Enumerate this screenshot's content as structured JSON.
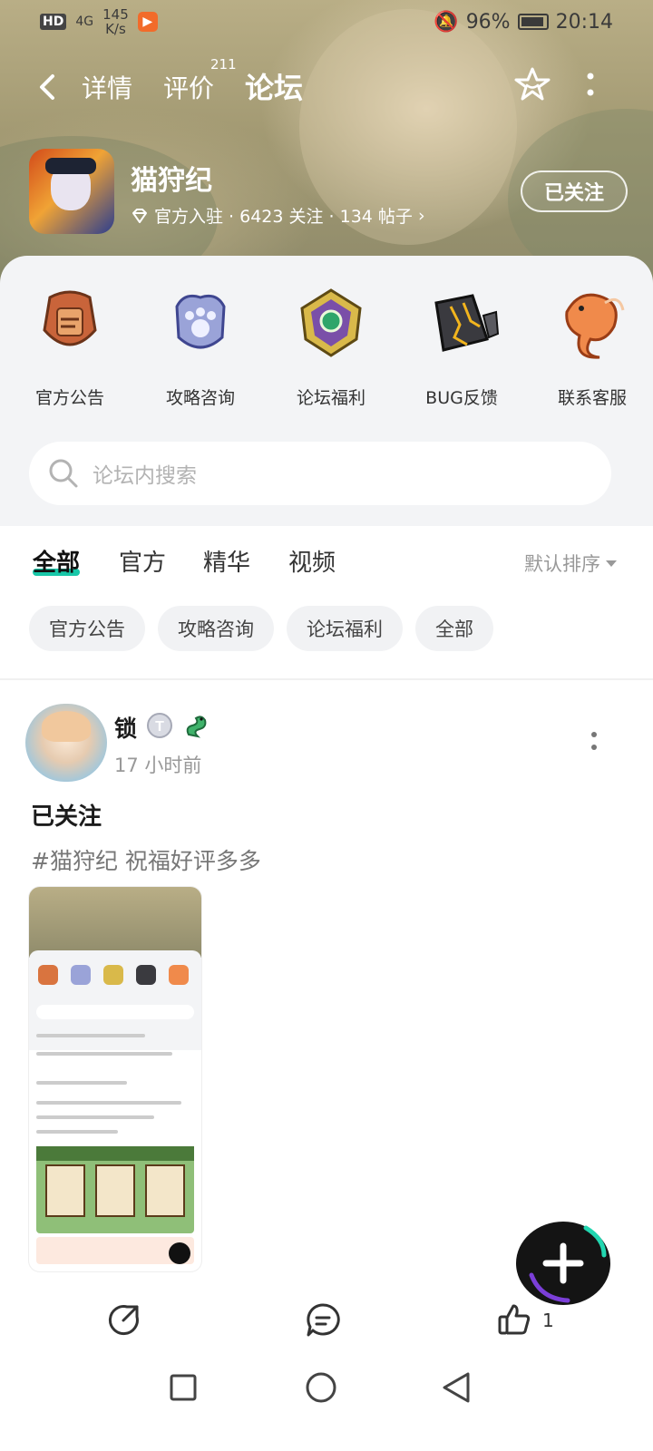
{
  "status_bar": {
    "hd": "HD",
    "network": "4G",
    "speed_value": "145",
    "speed_unit": "K/s",
    "battery": "96%",
    "time": "20:14"
  },
  "nav": {
    "tab_detail": "详情",
    "tab_review": "评价",
    "review_count": "211",
    "tab_forum": "论坛"
  },
  "game": {
    "name": "猫狩纪",
    "meta": "官方入驻 · 6423 关注 · 134 帖子",
    "follow_label": "已关注"
  },
  "categories": [
    {
      "label": "官方公告",
      "icon": "announcement-badge-icon"
    },
    {
      "label": "攻略咨询",
      "icon": "paw-badge-icon"
    },
    {
      "label": "论坛福利",
      "icon": "gem-badge-icon"
    },
    {
      "label": "BUG反馈",
      "icon": "broken-crystal-icon"
    },
    {
      "label": "联系客服",
      "icon": "koi-fish-icon"
    }
  ],
  "search": {
    "placeholder": "论坛内搜索"
  },
  "filter_tabs": [
    "全部",
    "官方",
    "精华",
    "视频"
  ],
  "sort_label": "默认排序",
  "chips": [
    "官方公告",
    "攻略咨询",
    "论坛福利",
    "全部"
  ],
  "post": {
    "username": "锁",
    "time": "17 小时前",
    "title": "已关注",
    "text": "#猫狩纪 祝福好评多多",
    "like_count": "1"
  },
  "colors": {
    "accent": "#18c7a8",
    "hero_bg": "#a39a73",
    "panel_bg": "#f3f4f6"
  }
}
